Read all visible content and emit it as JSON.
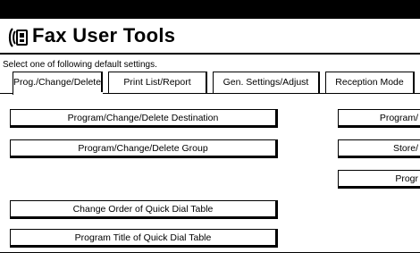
{
  "header": {
    "title": "Fax User Tools"
  },
  "instruction": "Select one of following default settings.",
  "tabs": [
    {
      "label": "Prog./Change/Delete",
      "active": true
    },
    {
      "label": "Print List/Report",
      "active": false
    },
    {
      "label": "Gen. Settings/Adjust",
      "active": false
    },
    {
      "label": "Reception Mode",
      "active": false
    },
    {
      "label": "",
      "active": false
    }
  ],
  "left_buttons": [
    {
      "label": "Program/Change/Delete Destination"
    },
    {
      "label": "Program/Change/Delete Group"
    },
    {
      "label": "Change Order of Quick Dial Table"
    },
    {
      "label": "Program Title of Quick Dial Table"
    }
  ],
  "right_buttons": [
    {
      "label": "Program/"
    },
    {
      "label": "Store/"
    },
    {
      "label": "Progr"
    }
  ]
}
